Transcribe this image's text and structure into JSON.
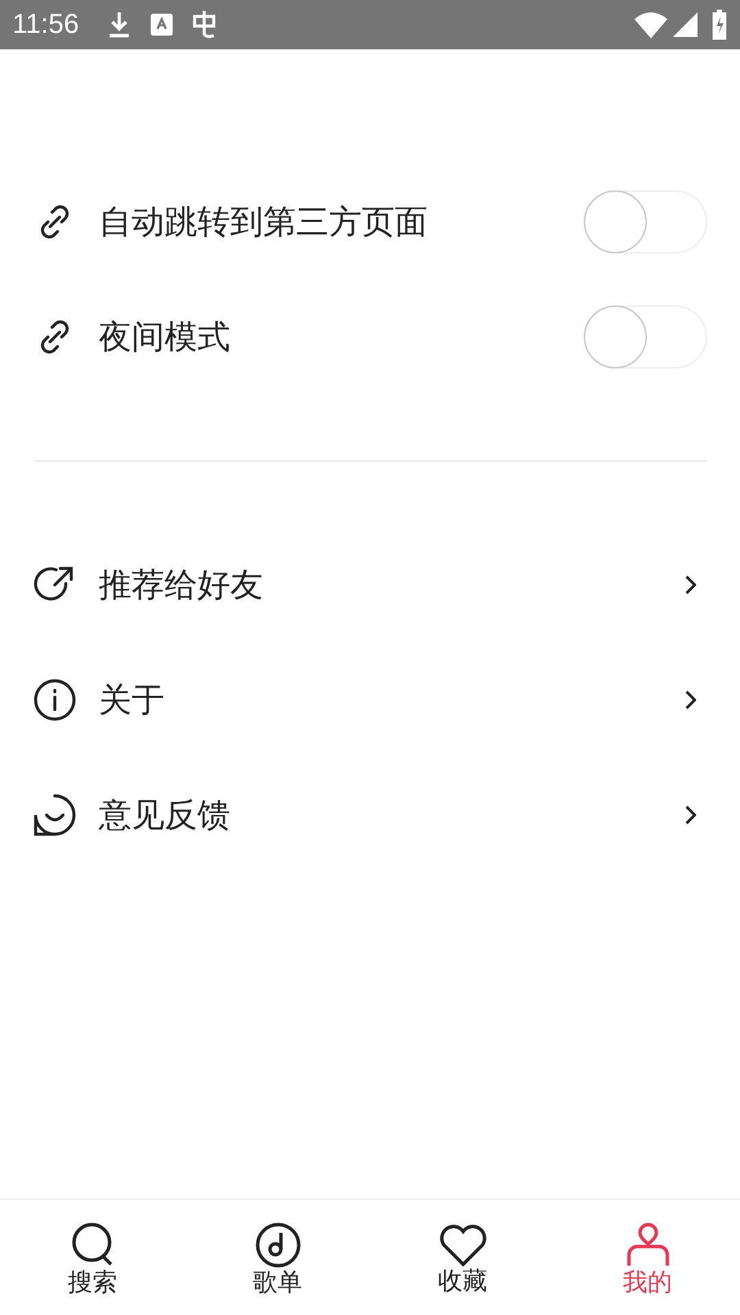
{
  "status_bar": {
    "time": "11:56"
  },
  "toggles": [
    {
      "label": "自动跳转到第三方页面",
      "on": false
    },
    {
      "label": "夜间模式",
      "on": false
    }
  ],
  "links": [
    {
      "label": "推荐给好友",
      "kind": "share"
    },
    {
      "label": "关于",
      "kind": "info"
    },
    {
      "label": "意见反馈",
      "kind": "feedback"
    }
  ],
  "tabs": [
    {
      "label": "搜索",
      "kind": "search",
      "selected": false
    },
    {
      "label": "歌单",
      "kind": "disc",
      "selected": false
    },
    {
      "label": "收藏",
      "kind": "heart",
      "selected": false
    },
    {
      "label": "我的",
      "kind": "person",
      "selected": true
    }
  ]
}
